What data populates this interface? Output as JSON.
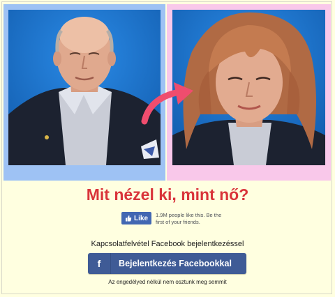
{
  "headline": "Mit nézel ki, mint nő?",
  "like": {
    "button_label": "Like",
    "text": "1.9M people like this. Be the first of your friends."
  },
  "login": {
    "label": "Kapcsolatfelvétel Facebook bejelentkezéssel",
    "button_icon": "f",
    "button_label": "Bejelentkezés Facebookkal",
    "disclaimer": "Az engedélyed nélkül nem osztunk meg semmit"
  },
  "colors": {
    "background": "#ffffe0",
    "left_panel": "#9ec2f4",
    "right_panel": "#f9c8ea",
    "headline": "#d9343a",
    "facebook_button": "#3f5b96",
    "like_button": "#4267b2",
    "arrow": "#ef4d6e"
  }
}
